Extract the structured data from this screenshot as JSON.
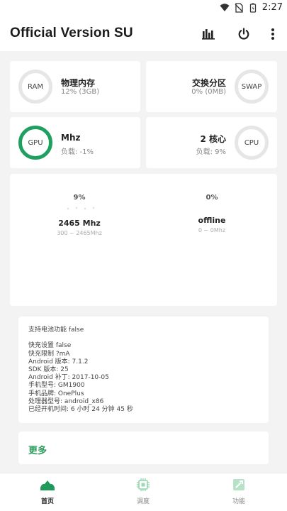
{
  "status_bar": {
    "time": "2:27",
    "icons": [
      "wifi-icon",
      "no-sim-icon",
      "battery-icon"
    ]
  },
  "app_bar": {
    "title": "Official Version SU",
    "actions": [
      "chart-icon",
      "power-icon",
      "more-vert-icon"
    ]
  },
  "memory": {
    "ram": {
      "ring_label": "RAM",
      "name": "物理内存",
      "value": "12% (3GB)"
    },
    "swap": {
      "ring_label": "SWAP",
      "name": "交换分区",
      "value": "0% (0MB)"
    }
  },
  "processors": {
    "gpu": {
      "ring_label": "GPU",
      "name": "Mhz",
      "load": "负载: -1%"
    },
    "cpu": {
      "ring_label": "CPU",
      "name": "2 核心",
      "load": "负载: 9%"
    }
  },
  "frequency": [
    {
      "percent": "9%",
      "value": "2465 Mhz",
      "range": "300 ~ 2465Mhz"
    },
    {
      "percent": "0%",
      "value": "offline",
      "range": "0 ~ 0Mhz"
    }
  ],
  "device_info": [
    "支持电池功能 false",
    "",
    "快充设置 false",
    "快充限制 ?mA",
    "Android 版本: 7.1.2",
    "SDK 版本: 25",
    "Android 补丁: 2017-10-05",
    "手机型号: GM1900",
    "手机品牌: OnePlus",
    "处理器型号: android_x86",
    "已经开机时间: 6 小时 24 分钟 45 秒"
  ],
  "more_label": "更多",
  "bottom_nav": [
    {
      "label": "首页",
      "icon": "home-icon",
      "active": true
    },
    {
      "label": "调度",
      "icon": "chip-icon",
      "active": false
    },
    {
      "label": "功能",
      "icon": "tools-icon",
      "active": false
    }
  ],
  "colors": {
    "accent": "#20a060",
    "ring_track": "#e6e6e6",
    "background": "#f3f3f3"
  }
}
